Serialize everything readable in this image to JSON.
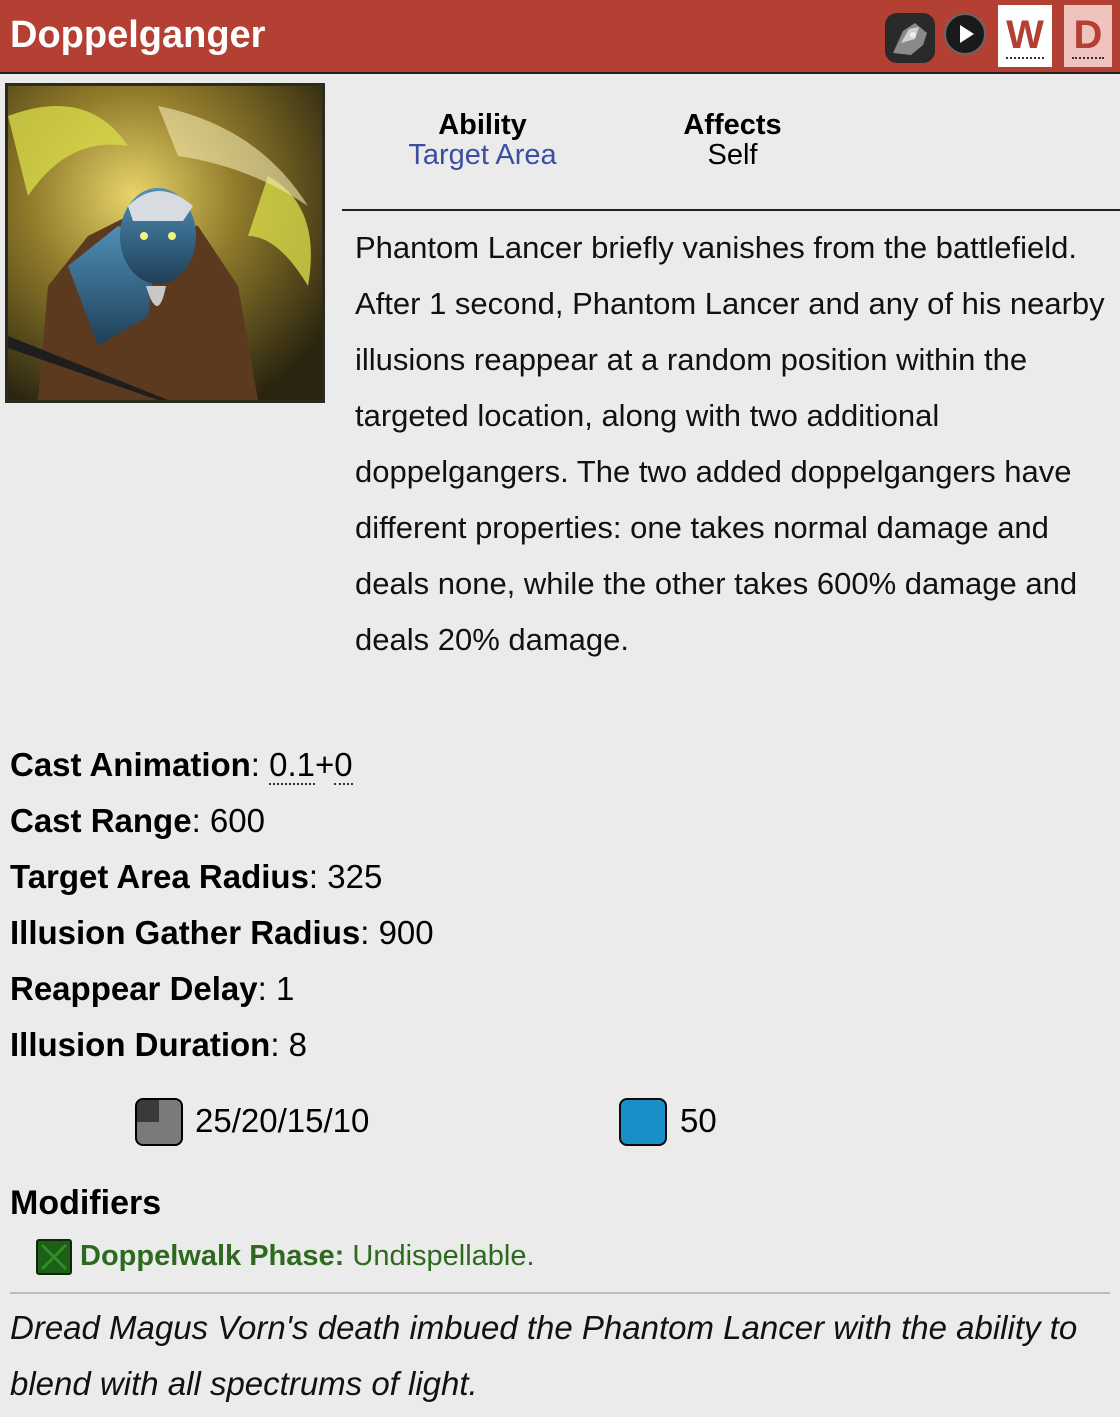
{
  "header": {
    "title": "Doppelganger",
    "hero_icon": "phantom-lancer-hero-icon",
    "play_icon": "play-icon",
    "w_label": "W",
    "d_label": "D",
    "bg_color": "#b44033"
  },
  "portrait": {
    "icon": "doppelganger-ability-icon"
  },
  "meta": {
    "ability_label": "Ability",
    "ability_value": "Target Area",
    "affects_label": "Affects",
    "affects_value": "Self"
  },
  "description": "Phantom Lancer briefly vanishes from the battlefield. After 1 second, Phantom Lancer and any of his nearby illusions reappear at a random position within the targeted location, along with two additional doppelgangers. The two added doppelgangers have different properties: one takes normal damage and deals none, while the other takes 600% damage and deals 20% damage.",
  "stats": {
    "cast_animation": {
      "label": "Cast Animation",
      "v1": "0.1",
      "plus": "+",
      "v2": "0"
    },
    "cast_range": {
      "label": "Cast Range",
      "value": "600"
    },
    "target_area_radius": {
      "label": "Target Area Radius",
      "value": "325"
    },
    "illusion_gather_radius": {
      "label": "Illusion Gather Radius",
      "value": "900"
    },
    "reappear_delay": {
      "label": "Reappear Delay",
      "value": "1"
    },
    "illusion_duration": {
      "label": "Illusion Duration",
      "value": "8"
    }
  },
  "costs": {
    "cooldown": "25/20/15/10",
    "mana": "50",
    "cooldown_icon": "cooldown-icon",
    "mana_icon": "mana-icon",
    "mana_color": "#1a8fc7"
  },
  "modifiers": {
    "heading": "Modifiers",
    "items": [
      {
        "name": "Doppelwalk Phase:",
        "desc": "Undispellable.",
        "color": "#2d6a1e"
      }
    ]
  },
  "lore": "Dread Magus Vorn's death imbued the Phantom Lancer with the ability to blend with all spectrums of light."
}
